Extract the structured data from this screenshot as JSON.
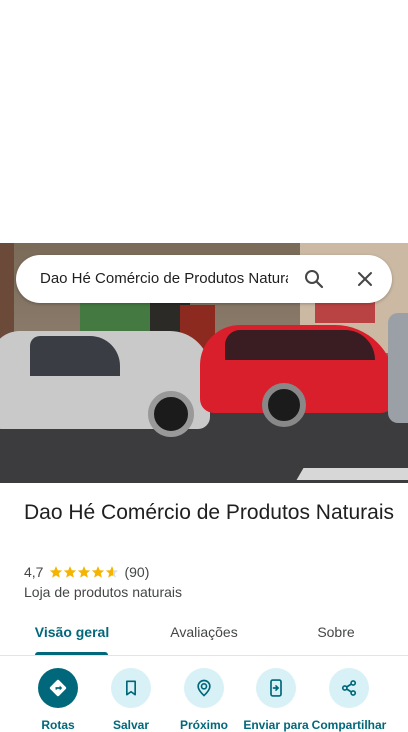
{
  "search": {
    "query": "Dao Hé Comércio de Produtos Naturais",
    "search_icon": "search-icon",
    "close_icon": "close-icon"
  },
  "photo": {
    "icon": "storefront-photo"
  },
  "place": {
    "title": "Dao Hé Comércio de Produtos Naturais",
    "rating": "4,7",
    "rating_value": 4.7,
    "reviews_count": "(90)",
    "category": "Loja de produtos naturais",
    "star_color": "#f4b400"
  },
  "tabs": [
    {
      "label": "Visão geral",
      "active": true
    },
    {
      "label": "Avaliações",
      "active": false
    },
    {
      "label": "Sobre",
      "active": false
    }
  ],
  "actions": [
    {
      "label": "Rotas",
      "icon": "directions-icon"
    },
    {
      "label": "Salvar",
      "icon": "bookmark-icon"
    },
    {
      "label": "Próximo",
      "icon": "nearby-icon"
    },
    {
      "label": "Enviar para",
      "icon": "send-to-phone-icon"
    },
    {
      "label": "Compartilhar",
      "icon": "share-icon"
    }
  ],
  "colors": {
    "accent": "#00687a",
    "accent_light": "#d7f1f6"
  }
}
